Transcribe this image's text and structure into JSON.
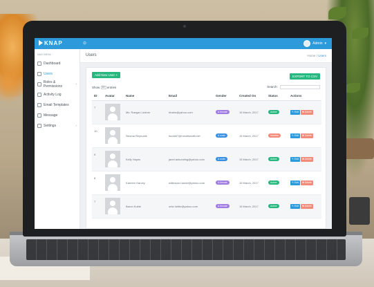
{
  "app": {
    "brand": "KNAP",
    "collapse_icon": "collapse-icon"
  },
  "user": {
    "name": "Admin",
    "caret": "▾"
  },
  "sidebar": {
    "title": "MAIN MENU",
    "items": [
      {
        "label": "Dashboard",
        "icon": "home-icon",
        "chevron": ""
      },
      {
        "label": "Users",
        "icon": "users-icon",
        "chevron": ""
      },
      {
        "label": "Roles & Permissions",
        "icon": "key-icon",
        "chevron": "›"
      },
      {
        "label": "Activity Log",
        "icon": "clock-icon",
        "chevron": ""
      },
      {
        "label": "Email Templates",
        "icon": "mail-icon",
        "chevron": ""
      },
      {
        "label": "Message",
        "icon": "chat-icon",
        "chevron": ""
      },
      {
        "label": "Settings",
        "icon": "gear-icon",
        "chevron": "›"
      }
    ]
  },
  "page": {
    "title": "Users",
    "breadcrumb": {
      "home": "Home",
      "sep": "/",
      "current": "Users"
    }
  },
  "toolbar": {
    "add_label": "Add New User +",
    "export_label": "EXPORT TO CSV"
  },
  "controls": {
    "show_prefix": "Show",
    "show_value": "10",
    "show_suffix": "entries",
    "search_label": "Search:"
  },
  "table": {
    "headers": [
      "ID",
      "Avatar",
      "Name",
      "Email",
      "Gender",
      "Created On",
      "Status",
      "Actions"
    ],
    "rows": [
      {
        "id": "7",
        "name": "Ms. Raegan Ledner",
        "email": "lrhahn@yahoo.com",
        "gender": "& female",
        "created": "15 March, 2017",
        "status": "Active"
      },
      {
        "id": "10",
        "name": "Neoma Reynolds",
        "email": "fsuda67@runolfsdottir.net",
        "gender": "& male",
        "created": "15 March, 2017",
        "status": "Inactive"
      },
      {
        "id": "9",
        "name": "Kelly Hayes",
        "email": "janet.ankunding@yahoo.com",
        "gender": "& male",
        "created": "15 March, 2017",
        "status": "Active"
      },
      {
        "id": "8",
        "name": "Kareem Harvey",
        "email": "wilkinson.harold@yahoo.com",
        "gender": "& female",
        "created": "15 March, 2017",
        "status": "Active"
      },
      {
        "id": "7",
        "name": "Baron Kuble",
        "email": "ortiz.hettie@yahoo.com",
        "gender": "& female",
        "created": "15 March, 2017",
        "status": "Active"
      }
    ],
    "edit_label": "✎ Edit",
    "delete_label": "✖ Delete"
  },
  "colors": {
    "topbar": "#2d9bdb",
    "accent_green": "#27b880",
    "female": "#a07de0",
    "male": "#3a8fe0",
    "inactive": "#f18b7a"
  }
}
